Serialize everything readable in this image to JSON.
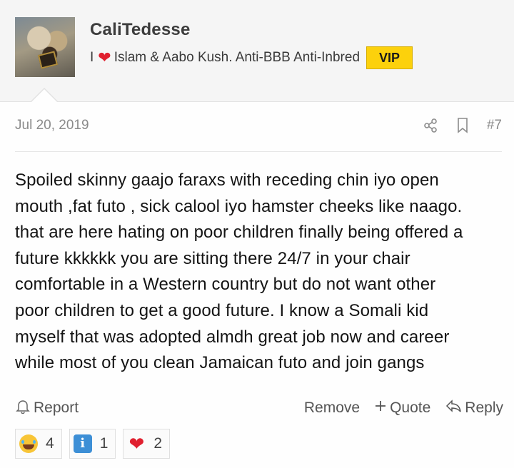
{
  "user": {
    "name": "CaliTedesse",
    "tagline_prefix": "I",
    "tagline_heart": "❤",
    "tagline_text": "Islam & Aabo Kush. Anti-BBB Anti-Inbred",
    "badge": "VIP"
  },
  "post": {
    "date": "Jul 20, 2019",
    "number": "#7",
    "lines": [
      "Spoiled skinny gaajo faraxs with receding chin iyo open",
      "mouth ,fat futo , sick calool iyo hamster cheeks like naago.",
      "that are here hating on poor children finally being offered a",
      "future kkkkkk you are sitting there 24/7 in your chair",
      "comfortable in a Western country but do not want other",
      "poor children to get a good future. I know a Somali kid",
      "myself that was adopted almdh great job now and career",
      "while most of you clean Jamaican futo and join gangs"
    ]
  },
  "actions": {
    "report": "Report",
    "remove": "Remove",
    "quote": "Quote",
    "reply": "Reply"
  },
  "reactions": [
    {
      "type": "laugh",
      "count": "4"
    },
    {
      "type": "info",
      "symbol": "i",
      "count": "1"
    },
    {
      "type": "heart",
      "symbol": "❤",
      "count": "2"
    }
  ],
  "colors": {
    "badge_bg": "#fcd10c",
    "heart": "#e0202f",
    "header_bg": "#f5f5f5"
  }
}
